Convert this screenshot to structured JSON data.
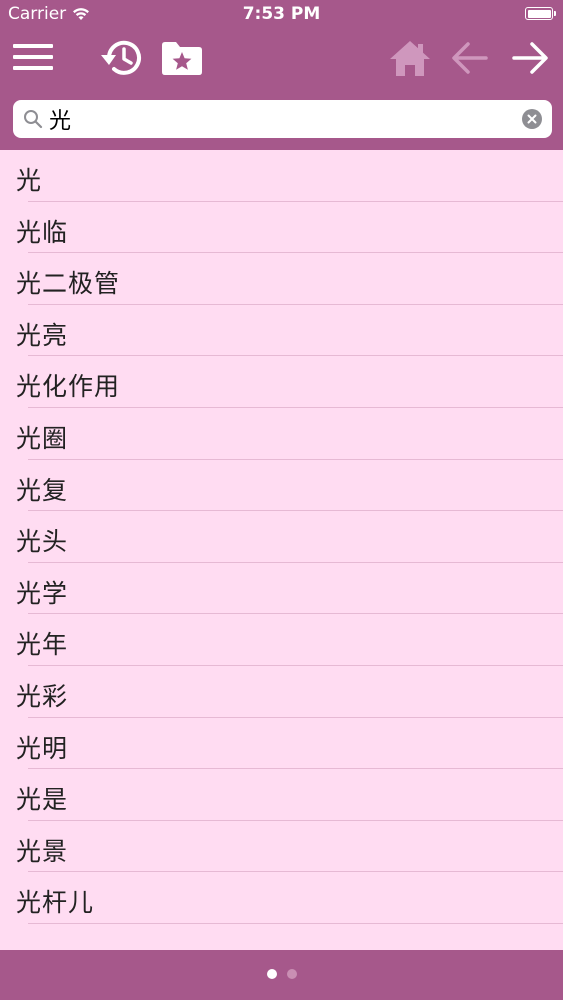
{
  "status_bar": {
    "carrier": "Carrier",
    "time": "7:53 PM"
  },
  "toolbar": {
    "icons": [
      "menu-icon",
      "history-icon",
      "favorites-folder-icon",
      "home-icon",
      "back-arrow-icon",
      "forward-arrow-icon"
    ],
    "colors": {
      "bar": "#a6588b",
      "icon_active": "#ffffff",
      "icon_disabled": "#cf97bd"
    }
  },
  "search": {
    "value": "光",
    "placeholder": ""
  },
  "list": {
    "items": [
      {
        "label": "光"
      },
      {
        "label": "光临"
      },
      {
        "label": "光二极管"
      },
      {
        "label": "光亮"
      },
      {
        "label": "光化作用"
      },
      {
        "label": "光圈"
      },
      {
        "label": "光复"
      },
      {
        "label": "光头"
      },
      {
        "label": "光学"
      },
      {
        "label": "光年"
      },
      {
        "label": "光彩"
      },
      {
        "label": "光明"
      },
      {
        "label": "光是"
      },
      {
        "label": "光景"
      },
      {
        "label": "光杆儿"
      }
    ],
    "background": "#ffdcf2"
  },
  "pager": {
    "pages": 2,
    "current": 1
  }
}
